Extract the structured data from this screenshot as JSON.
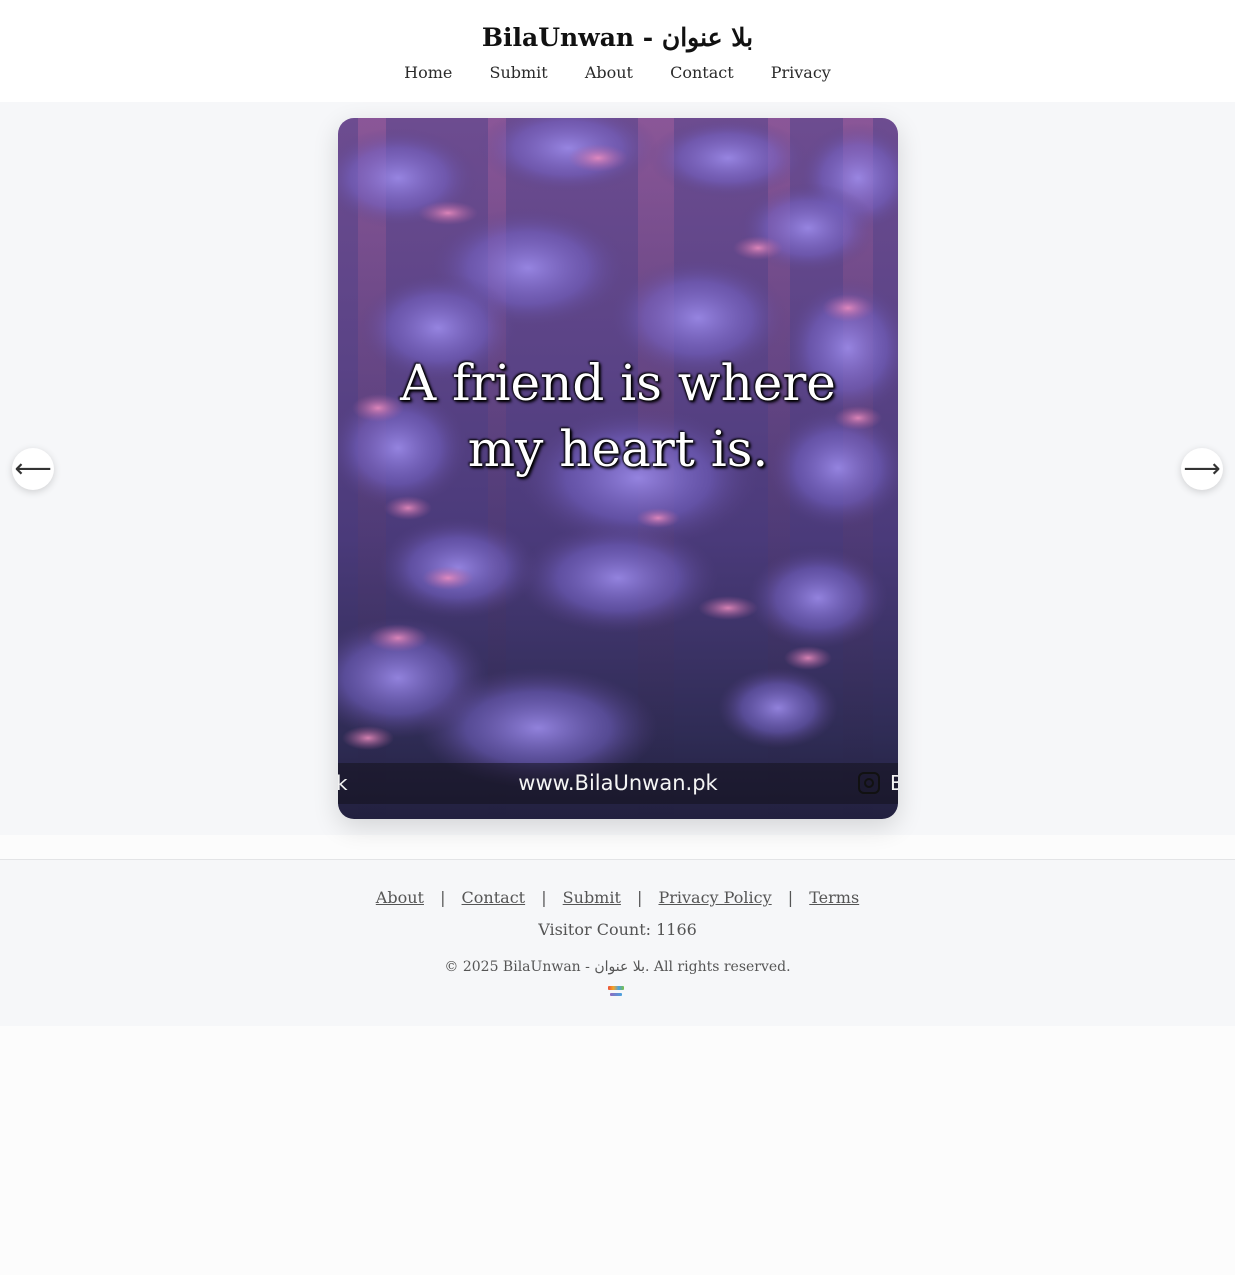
{
  "header": {
    "title": "BilaUnwan - بلا عنوان",
    "nav": [
      "Home",
      "Submit",
      "About",
      "Contact",
      "Privacy"
    ]
  },
  "slide": {
    "quote_line1": "A friend is where",
    "quote_line2": "my heart is.",
    "banner_url": "www.BilaUnwan.pk",
    "banner_left_fragment": "k",
    "banner_right_fragment": "B"
  },
  "carousel": {
    "prev_symbol": "⟵",
    "next_symbol": "⟶"
  },
  "footer": {
    "links": [
      "About",
      "Contact",
      "Submit",
      "Privacy Policy",
      "Terms"
    ],
    "separator": "|",
    "visitor_count": "Visitor Count: 1166",
    "copyright": "© 2025 BilaUnwan - بلا عنوان. All rights reserved."
  },
  "icons": {
    "instagram": "instagram-icon",
    "prev": "arrow-left-icon",
    "next": "arrow-right-icon",
    "logo": "site-logo-icon"
  },
  "colors": {
    "stage_background": "#f6f7f9",
    "card_purple": "#5a4386",
    "text_dark": "#2b2b2b"
  }
}
